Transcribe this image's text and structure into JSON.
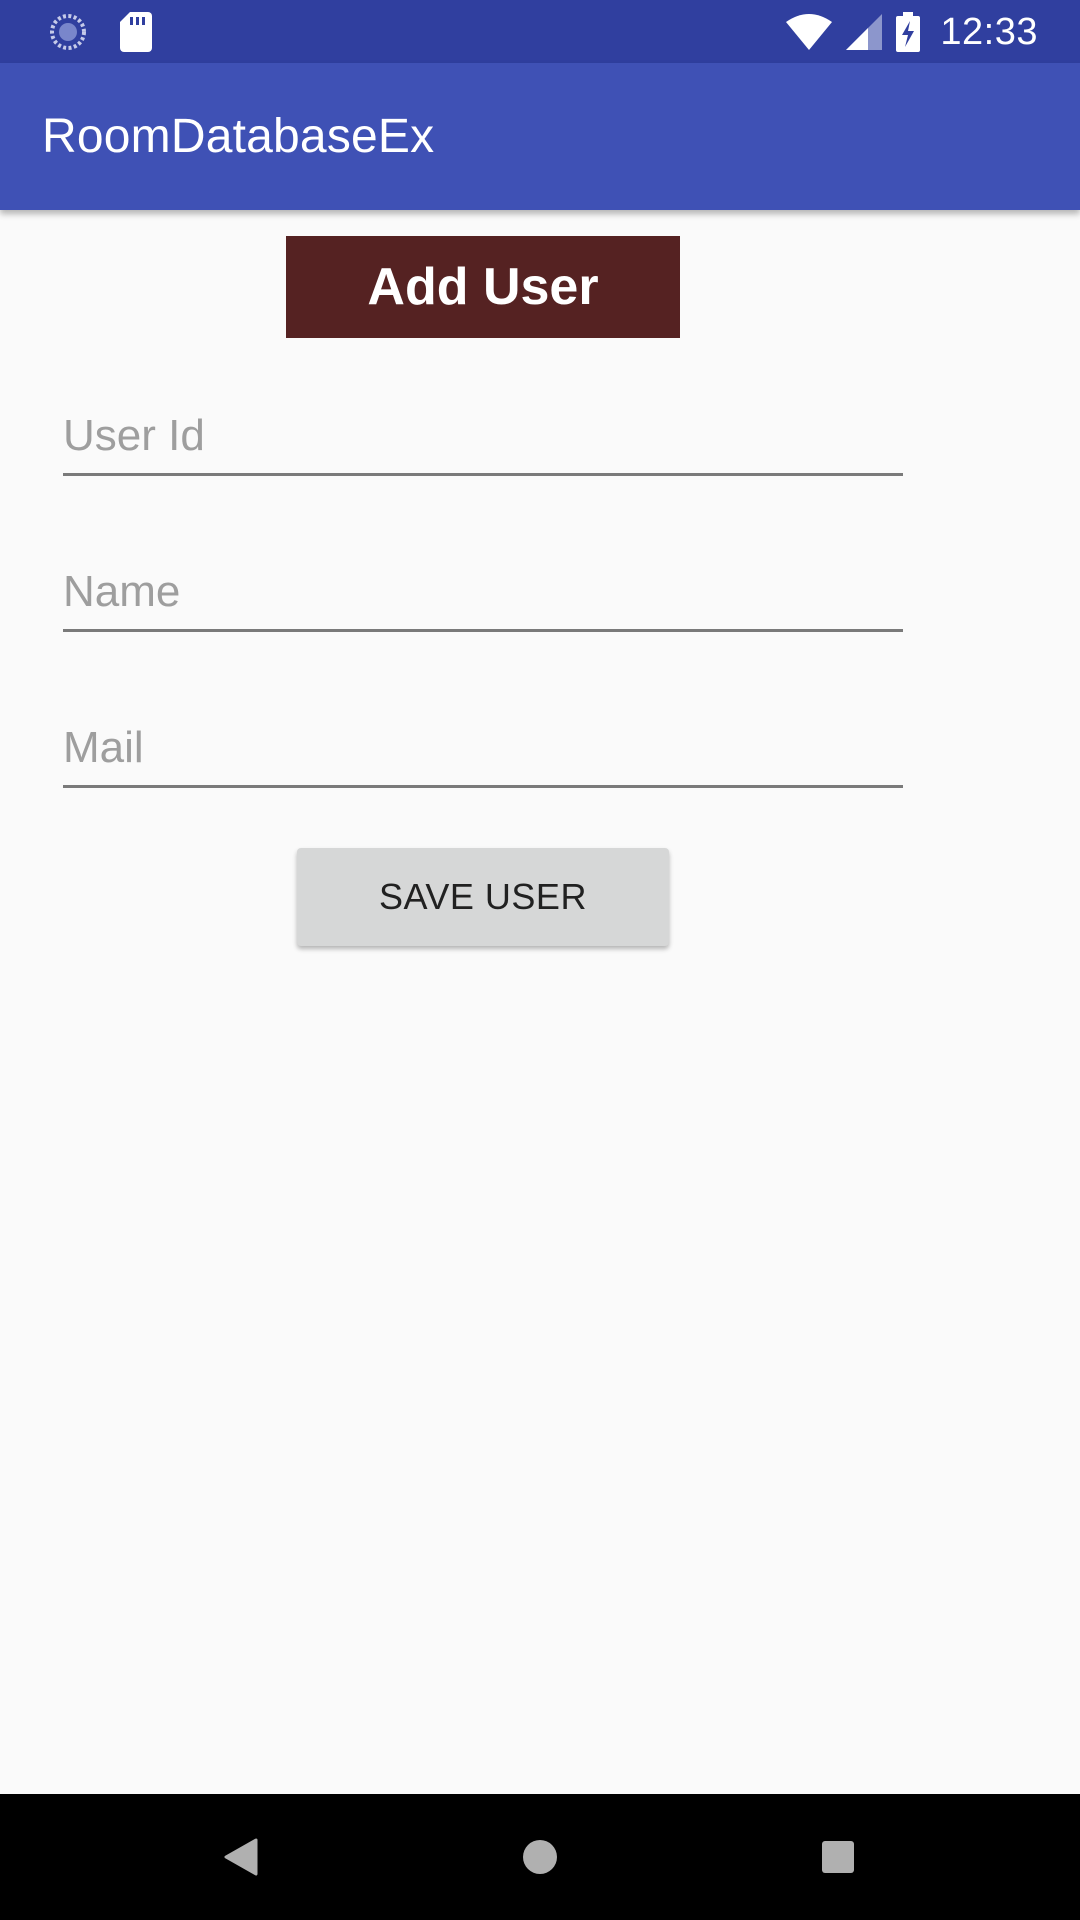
{
  "status_bar": {
    "time": "12:33",
    "icons": [
      "sync-icon",
      "sd-card-icon",
      "wifi-icon",
      "signal-icon",
      "battery-charging-icon"
    ],
    "background_color": "#303f9f"
  },
  "app_bar": {
    "title": "RoomDatabaseEx",
    "background_color": "#3f51b5"
  },
  "content": {
    "header_label": "Add User",
    "header_color": "#552222",
    "fields": {
      "user_id": {
        "placeholder": "User Id",
        "value": ""
      },
      "name": {
        "placeholder": "Name",
        "value": ""
      },
      "mail": {
        "placeholder": "Mail",
        "value": ""
      }
    },
    "save_button_label": "SAVE USER"
  },
  "nav_bar": {
    "buttons": [
      "back-icon",
      "home-icon",
      "recents-icon"
    ]
  }
}
